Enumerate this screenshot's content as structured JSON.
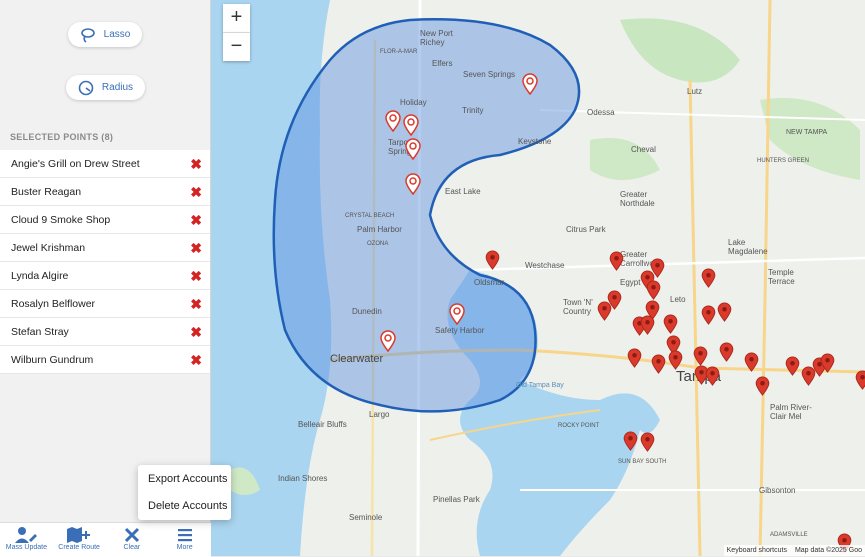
{
  "tools": {
    "lasso_label": "Lasso",
    "radius_label": "Radius"
  },
  "selected": {
    "header": "SELECTED POINTS (8)",
    "items": [
      "Angie's Grill on Drew Street",
      "Buster Reagan",
      "Cloud 9 Smoke Shop",
      "Jewel Krishman",
      "Lynda Algire",
      "Rosalyn Belflower",
      "Stefan Stray",
      "Wilburn Gundrum"
    ],
    "remove_glyph": "✖"
  },
  "bottom_bar": {
    "mass_update": "Mass Update",
    "create_route": "Create Route",
    "clear": "Clear",
    "more": "More"
  },
  "more_menu": {
    "export": "Export Accounts",
    "delete": "Delete Accounts"
  },
  "map": {
    "zoom_in": "+",
    "zoom_out": "−",
    "attribution": {
      "shortcuts": "Keyboard shortcuts",
      "data": "Map data ©2025 Goo"
    },
    "labels": {
      "new_port_richey": "New Port\nRichey",
      "flor_a_mar": "FLOR-A-MAR",
      "elfers": "Elfers",
      "seven_springs": "Seven Springs",
      "holiday": "Holiday",
      "trinity": "Trinity",
      "keystone": "Keystone",
      "odessa": "Odessa",
      "tarpon": "Tarpon\nSprings",
      "east_lake": "East Lake",
      "cheval": "Cheval",
      "greater_northdale": "Greater\nNorthdale",
      "crystal_beach": "CRYSTAL BEACH",
      "palm_harbor": "Palm Harbor",
      "citrus_park": "Citrus Park",
      "ozona": "OZONA",
      "westchase": "Westchase",
      "oldsmar": "Oldsmar",
      "greater_carrollwood": "Greater\nCarrollwood",
      "town_n_country": "Town 'N'\nCountry",
      "dunedin": "Dunedin",
      "safety_harbor": "Safety Harbor",
      "clearwater": "Clearwater",
      "old_tampa_bay": "Old Tampa Bay",
      "tampa": "Tampa",
      "largo": "Largo",
      "belleair_bluffs": "Belleair Bluffs",
      "rocky_point": "ROCKY POINT",
      "pinellas_park": "Pinellas Park",
      "indian_shores": "Indian Shores",
      "seminole": "Seminole",
      "sun_bay_south": "SUN BAY SOUTH",
      "gibsonton": "Gibsonton",
      "temple_terrace": "Temple\nTerrace",
      "new_tampa": "NEW TAMPA",
      "hunters_green": "HUNTERS GREEN",
      "lutz": "Lutz",
      "adamsville": "ADAMSVILLE",
      "palm_river": "Palm River-\nClair Mel",
      "lake_magdalene": "Lake\nMagdalene",
      "egypt": "Egypt",
      "leto": "Leto"
    }
  },
  "colors": {
    "accent": "#3a6fb8",
    "remove": "#d32424",
    "pin_red": "#d93a2b",
    "selection_fill": "#5b8fe0",
    "selection_stroke": "#1f5fb5",
    "water": "#a9d5f0"
  }
}
